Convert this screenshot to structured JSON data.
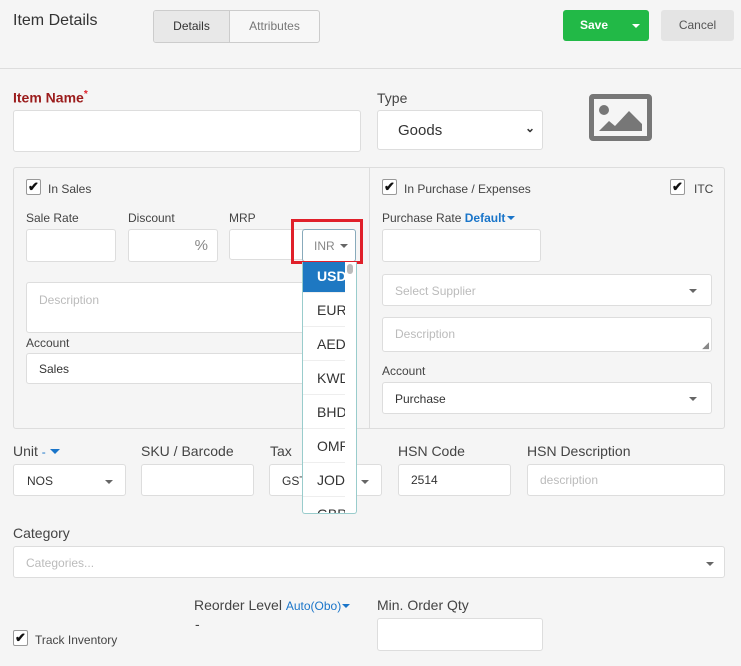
{
  "header": {
    "title": "Item Details",
    "tabs": [
      {
        "label": "Details",
        "active": true
      },
      {
        "label": "Attributes",
        "active": false
      }
    ],
    "save_label": "Save",
    "cancel_label": "Cancel"
  },
  "colors": {
    "save": "#22b947",
    "accent": "#1a75c9",
    "required": "#9b1c1c",
    "highlight_box": "#e0202a",
    "selected_option": "#1e78c2"
  },
  "item": {
    "name_label": "Item Name",
    "required_mark": "*",
    "name_value": "",
    "type_label": "Type",
    "type_value": "Goods",
    "image_icon": "image-placeholder-icon"
  },
  "sales": {
    "checkbox_label": "In Sales",
    "checked": true,
    "sale_rate_label": "Sale Rate",
    "discount_label": "Discount",
    "discount_unit": "%",
    "mrp_label": "MRP",
    "currency_value": "INR",
    "description_placeholder": "Description",
    "account_label": "Account",
    "account_value": "Sales"
  },
  "currency_dropdown": {
    "options": [
      "USD",
      "EUR",
      "AED",
      "KWD",
      "BHD",
      "OMR",
      "JOD",
      "GBP"
    ],
    "selected": "USD"
  },
  "purchase": {
    "checkbox_label": "In Purchase / Expenses",
    "checked": true,
    "itc_label": "ITC",
    "itc_checked": true,
    "rate_label": "Purchase Rate",
    "rate_mode": "Default",
    "supplier_placeholder": "Select Supplier",
    "description_placeholder": "Description",
    "account_label": "Account",
    "account_value": "Purchase"
  },
  "details": {
    "unit_label": "Unit",
    "unit_mode": "-",
    "unit_value": "NOS",
    "sku_label": "SKU / Barcode",
    "tax_label": "Tax",
    "tax_value": "GST",
    "hsn_label": "HSN Code",
    "hsn_value": "2514",
    "hsn_desc_label": "HSN Description",
    "hsn_desc_placeholder": "description"
  },
  "category": {
    "label": "Category",
    "placeholder": "Categories..."
  },
  "inventory": {
    "track_label": "Track Inventory",
    "track_checked": true,
    "reorder_label": "Reorder Level",
    "reorder_mode": "Auto(Obo)",
    "reorder_value": "-",
    "min_qty_label": "Min. Order Qty"
  }
}
